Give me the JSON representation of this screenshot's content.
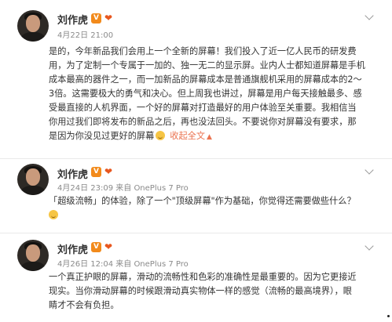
{
  "posts": [
    {
      "author": "刘作虎",
      "verified_badge": "V",
      "meta": "4月22日 21:00",
      "lines": [
        "是的，今年新品我们会用上一个全新的屏幕！我们投入了近一亿人民币的研发费",
        "用，为了定制一个专属于一加的、独一无二的显示屏。业内人士都知道屏幕是手机",
        "成本最高的器件之一，而一加新品的屏幕成本是普通旗舰机采用的屏幕成本的2～",
        "3倍。这需要极大的勇气和决心。但上周我也讲过，屏幕是用户每天接触最多、感",
        "受最直接的人机界面，一个好的屏幕对打造最好的用户体验至关重要。我相信当",
        "你用过我们即将发布的新品之后，再也没法回头。不要说你对屏幕没有要求，那",
        "是因为你没见过更好的屏幕"
      ],
      "collapse_label": "收起全文"
    },
    {
      "author": "刘作虎",
      "verified_badge": "V",
      "meta": "4月24日 23:09 来自 OnePlus 7 Pro",
      "lines": [
        "「超级流畅」的体验，除了一个\"顶级屏幕\"作为基础，你觉得还需要做些什么？"
      ]
    },
    {
      "author": "刘作虎",
      "verified_badge": "V",
      "meta": "4月26日 12:04 来自 OnePlus 7 Pro",
      "lines": [
        "一个真正护眼的屏幕，滑动的流畅性和色彩的准确性是最重要的。因为它更接近",
        "现实。当你滑动屏幕的时候跟滑动真实物体一样的感觉（流畅的最高境界），眼",
        "睛才不会有负担。"
      ]
    }
  ],
  "icons": {
    "chevron": "chevron-down-icon",
    "verified": "verified-v-icon",
    "badge": "heart-badge-icon",
    "emoji": "smile-emoji-icon"
  },
  "colors": {
    "accent": "#eb7350",
    "verified": "#f28a1b",
    "meta": "#8a8a8a",
    "text": "#333333"
  }
}
